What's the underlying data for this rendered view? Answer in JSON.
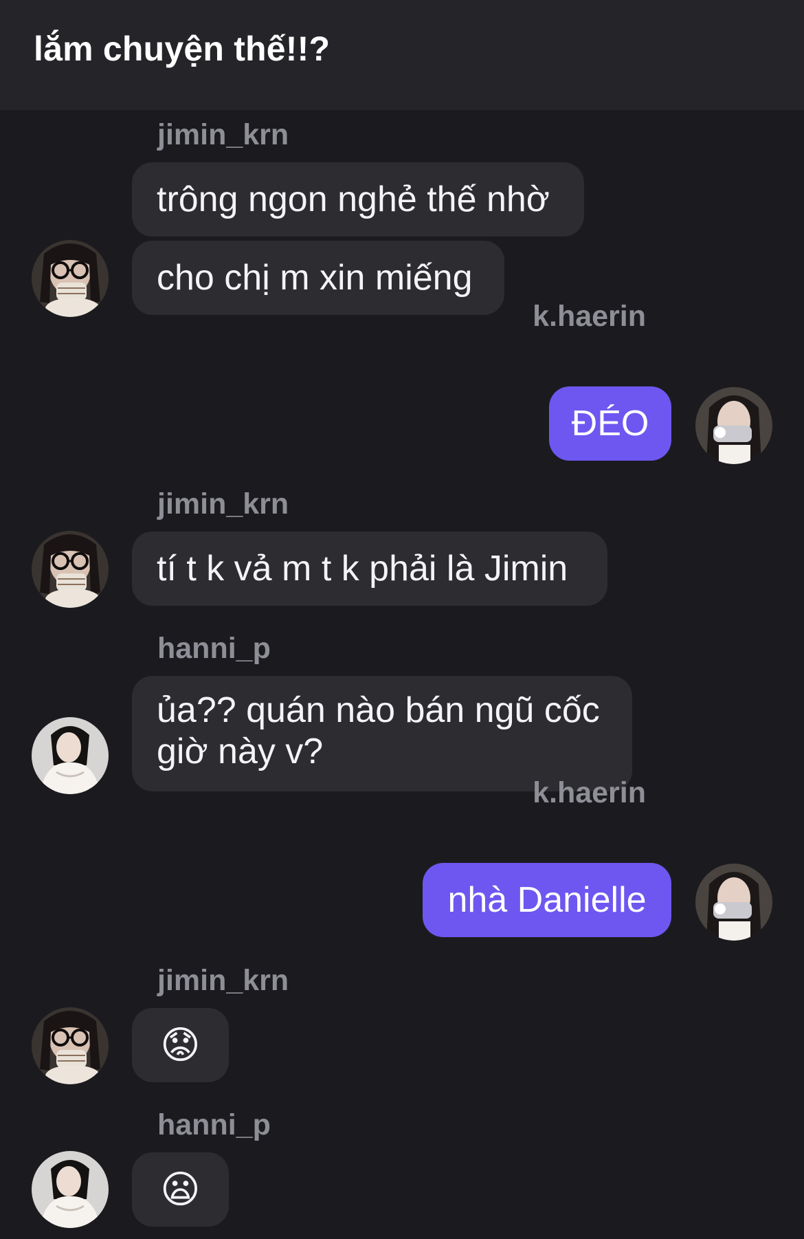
{
  "header": {
    "title": "lắm chuyện thế!!?"
  },
  "messages": [
    {
      "username": "jimin_krn",
      "lines": [
        "trông ngon nghẻ thế nhờ",
        "cho chị m xin miếng"
      ]
    },
    {
      "username": "k.haerin",
      "lines": [
        "ĐÉO"
      ]
    },
    {
      "username": "jimin_krn",
      "lines": [
        "tí t k vả m t k phải là Jimin"
      ]
    },
    {
      "username": "hanni_p",
      "lines": [
        "ủa?? quán nào bán ngũ cốc giờ này v?"
      ]
    },
    {
      "username": "k.haerin",
      "lines": [
        "nhà Danielle"
      ]
    },
    {
      "username": "jimin_krn",
      "lines": [
        "😟"
      ]
    },
    {
      "username": "hanni_p",
      "lines": [
        "😦"
      ]
    }
  ],
  "colors": {
    "background": "#1b1b1f",
    "header_background": "#252529",
    "incoming_bubble": "#2c2c31",
    "outgoing_bubble": "#6d57f0",
    "username_text": "#8e8e96"
  },
  "icons": {
    "jimin_avatar": "avatar-glasses-cup",
    "haerin_avatar": "avatar-mirror-selfie",
    "hanni_avatar": "avatar-white-jacket"
  }
}
